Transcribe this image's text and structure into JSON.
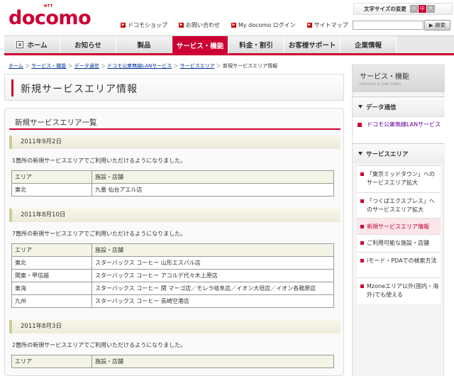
{
  "header": {
    "logo_small": "NTT",
    "logo": "docomo",
    "topnav": [
      "ドコモショップ",
      "お問い合わせ",
      "My docomo ログイン",
      "サイトマップ"
    ],
    "font_size_label": "文字サイズの変更",
    "font_sizes": [
      "小",
      "中",
      "大"
    ],
    "search_button": "検索"
  },
  "gnav": [
    "ホーム",
    "お知らせ",
    "製品",
    "サービス・機能",
    "料金・割引",
    "お客様サポート",
    "企業情報"
  ],
  "breadcrumb": [
    "ホーム",
    "サービス・機能",
    "データ通信",
    "ドコモ公衆無線LANサービス",
    "サービスエリア",
    "新規サービスエリア情報"
  ],
  "page_title": "新規サービスエリア情報",
  "panel_title": "新規サービスエリア一覧",
  "columns": [
    "エリア",
    "施設・店舗"
  ],
  "sections": [
    {
      "date": "2011年9月2日",
      "text": "1箇所の新規サービスエリアでご利用いただけるようになりました。",
      "rows": [
        [
          "東北",
          "九番 仙台アエル店"
        ]
      ]
    },
    {
      "date": "2011年8月10日",
      "text": "7箇所の新規サービスエリアでご利用いただけるようになりました。",
      "rows": [
        [
          "東北",
          "スターバックス コーヒー 山形エスパル店"
        ],
        [
          "関東・甲信越",
          "スターバックス コーヒー アコルデ代々木上原店"
        ],
        [
          "東海",
          "スターバックス コーヒー 関 マーゴ店／モレラ岐阜店／イオン大垣店／イオン各務原店"
        ],
        [
          "九州",
          "スターバックス コーヒー 長崎空港店"
        ]
      ]
    },
    {
      "date": "2011年8月3日",
      "text": "2箇所の新規サービスエリアでご利用いただけるようになりました。",
      "rows": []
    }
  ],
  "sidebar": {
    "title": "サービス・機能",
    "subtitle": "[SERVICES & FUNCTIONS]",
    "cat1": "データ通信",
    "sub1": "ドコモ公衆無線LANサービス",
    "cat2": "サービスエリア",
    "items": [
      "「東京ミッドタウン」へのサービスエリア拡大",
      "「つくばエクスプレス」へのサービスエリア拡大",
      "新規サービスエリア情報",
      "ご利用可能な施設・店舗",
      "iモード・PDAでの検索方法",
      "Mzoneエリア以外(国内・海外)でも使える"
    ]
  }
}
